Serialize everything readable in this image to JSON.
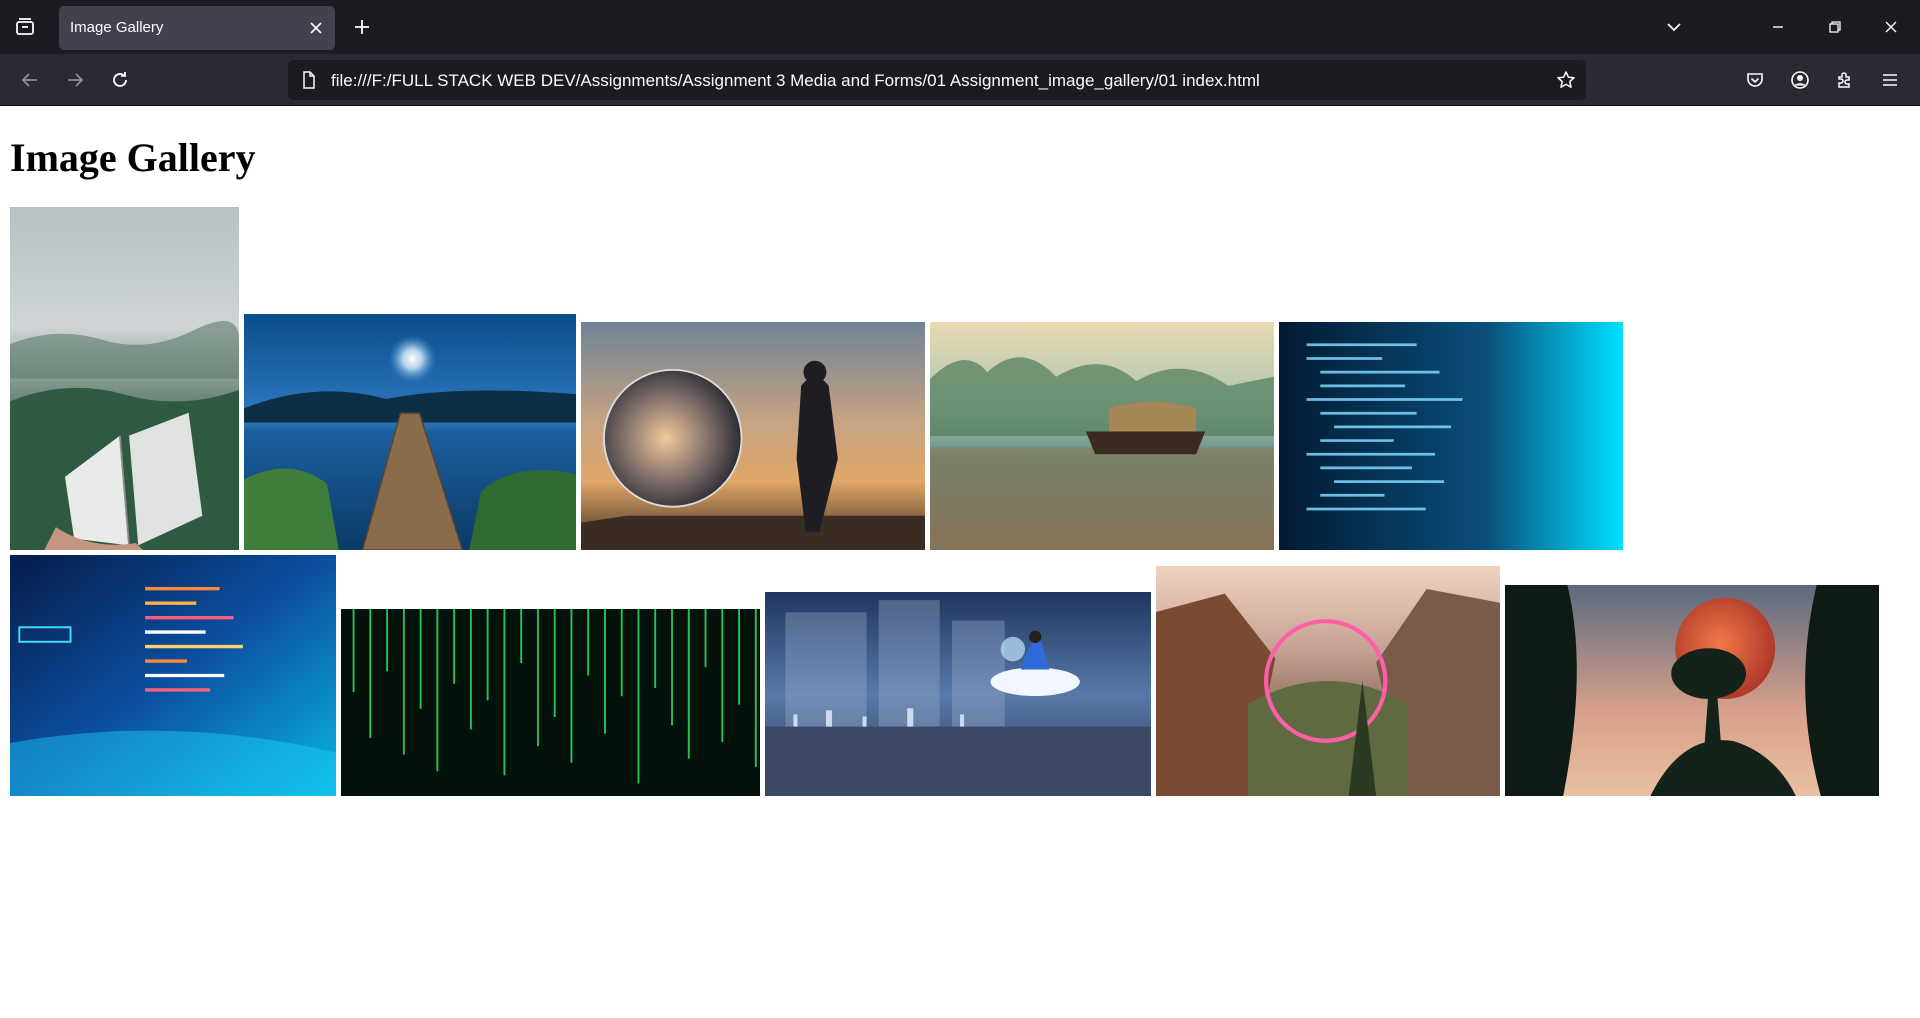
{
  "browser": {
    "tab_title": "Image Gallery",
    "url": "file:///F:/FULL STACK WEB DEV/Assignments/Assignment 3 Media and Forms/01 Assignment_image_gallery/01 index.html"
  },
  "page": {
    "title": "Image Gallery"
  },
  "gallery": [
    {
      "name": "book-in-misty-forest"
    },
    {
      "name": "lake-pier-moonlight"
    },
    {
      "name": "crystal-ball-sunset"
    },
    {
      "name": "houseboat-backwaters"
    },
    {
      "name": "code-on-blue-screen"
    },
    {
      "name": "colorful-code-abstract"
    },
    {
      "name": "green-matrix-rain"
    },
    {
      "name": "girl-on-cloud-city"
    },
    {
      "name": "neon-ring-valley"
    },
    {
      "name": "tree-under-red-moon"
    }
  ],
  "colors": {
    "tabbar_bg": "#1c1b22",
    "navbar_bg": "#2b2a33",
    "tab_active_bg": "#42414d",
    "chrome_text": "#fbfbfe"
  }
}
